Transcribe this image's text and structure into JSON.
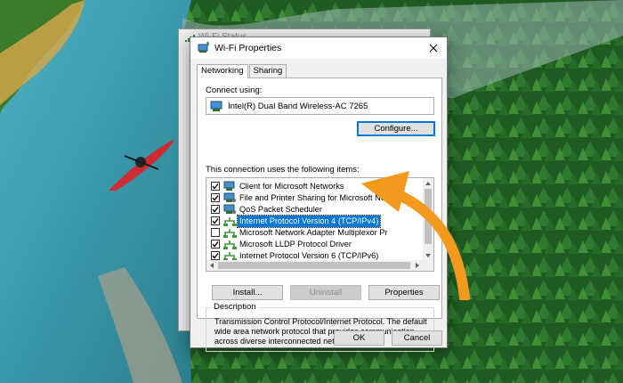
{
  "background_window": {
    "title": "Wi-Fi Status"
  },
  "dialog": {
    "title": "Wi-Fi Properties",
    "tabs": [
      {
        "label": "Networking",
        "active": true
      },
      {
        "label": "Sharing",
        "active": false
      }
    ],
    "connect_using_label": "Connect using:",
    "adapter_name": "Intel(R) Dual Band Wireless-AC 7265",
    "configure_button": "Configure...",
    "items_label": "This connection uses the following items:",
    "items": [
      {
        "label": "Client for Microsoft Networks",
        "checked": true,
        "icon": "network-client-icon",
        "selected": false
      },
      {
        "label": "File and Printer Sharing for Microsoft Networks",
        "checked": true,
        "icon": "network-service-icon",
        "selected": false
      },
      {
        "label": "QoS Packet Scheduler",
        "checked": true,
        "icon": "network-service-icon",
        "selected": false
      },
      {
        "label": "Internet Protocol Version 4 (TCP/IPv4)",
        "checked": true,
        "icon": "network-protocol-icon",
        "selected": true
      },
      {
        "label": "Microsoft Network Adapter Multiplexor Pr",
        "checked": false,
        "icon": "network-protocol-icon",
        "selected": false
      },
      {
        "label": "Microsoft LLDP Protocol Driver",
        "checked": true,
        "icon": "network-protocol-icon",
        "selected": false
      },
      {
        "label": "Internet Protocol Version 6 (TCP/IPv6)",
        "checked": true,
        "icon": "network-protocol-icon",
        "selected": false
      }
    ],
    "install_button": "Install...",
    "uninstall_button": "Uninstall",
    "properties_button": "Properties",
    "description_label": "Description",
    "description_text": "Transmission Control Protocol/Internet Protocol. The default wide area network protocol that provides communication across diverse interconnected networks.",
    "ok_button": "OK",
    "cancel_button": "Cancel"
  },
  "colors": {
    "accent": "#0078d7",
    "callout_arrow": "#f39a1e",
    "dialog_bg": "#f0f0f0"
  }
}
